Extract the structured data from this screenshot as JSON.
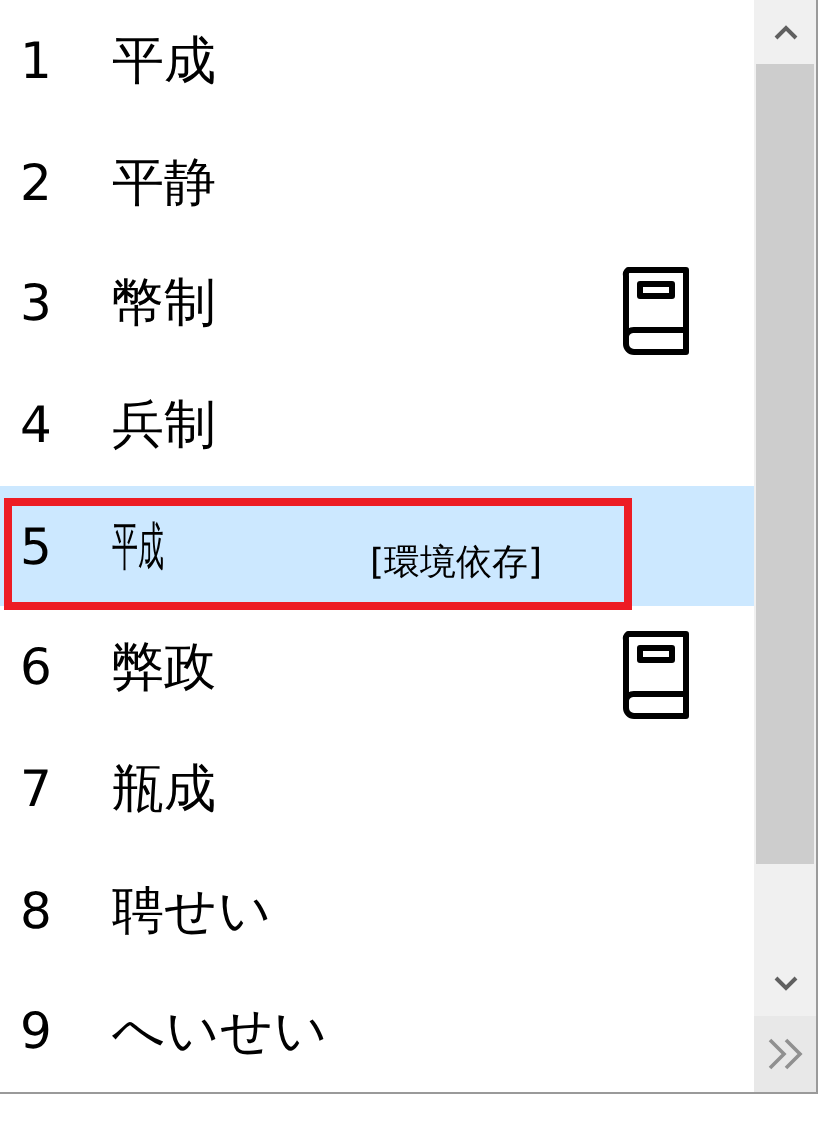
{
  "candidates": [
    {
      "number": "1",
      "text": "平成",
      "selected": false,
      "dictionary": false,
      "outlined": false
    },
    {
      "number": "2",
      "text": "平静",
      "selected": false,
      "dictionary": false,
      "outlined": false
    },
    {
      "number": "3",
      "text": "幣制",
      "selected": false,
      "dictionary": true,
      "outlined": false
    },
    {
      "number": "4",
      "text": "兵制",
      "selected": false,
      "dictionary": false,
      "outlined": false
    },
    {
      "number": "5",
      "text": "㍻",
      "selected": true,
      "dictionary": false,
      "outlined": true,
      "tag": "[環境依存]"
    },
    {
      "number": "6",
      "text": "弊政",
      "selected": false,
      "dictionary": true,
      "outlined": false
    },
    {
      "number": "7",
      "text": "瓶成",
      "selected": false,
      "dictionary": false,
      "outlined": false
    },
    {
      "number": "8",
      "text": "聘せい",
      "selected": false,
      "dictionary": false,
      "outlined": false
    },
    {
      "number": "9",
      "text": "へいせい",
      "selected": false,
      "dictionary": false,
      "outlined": false
    }
  ]
}
